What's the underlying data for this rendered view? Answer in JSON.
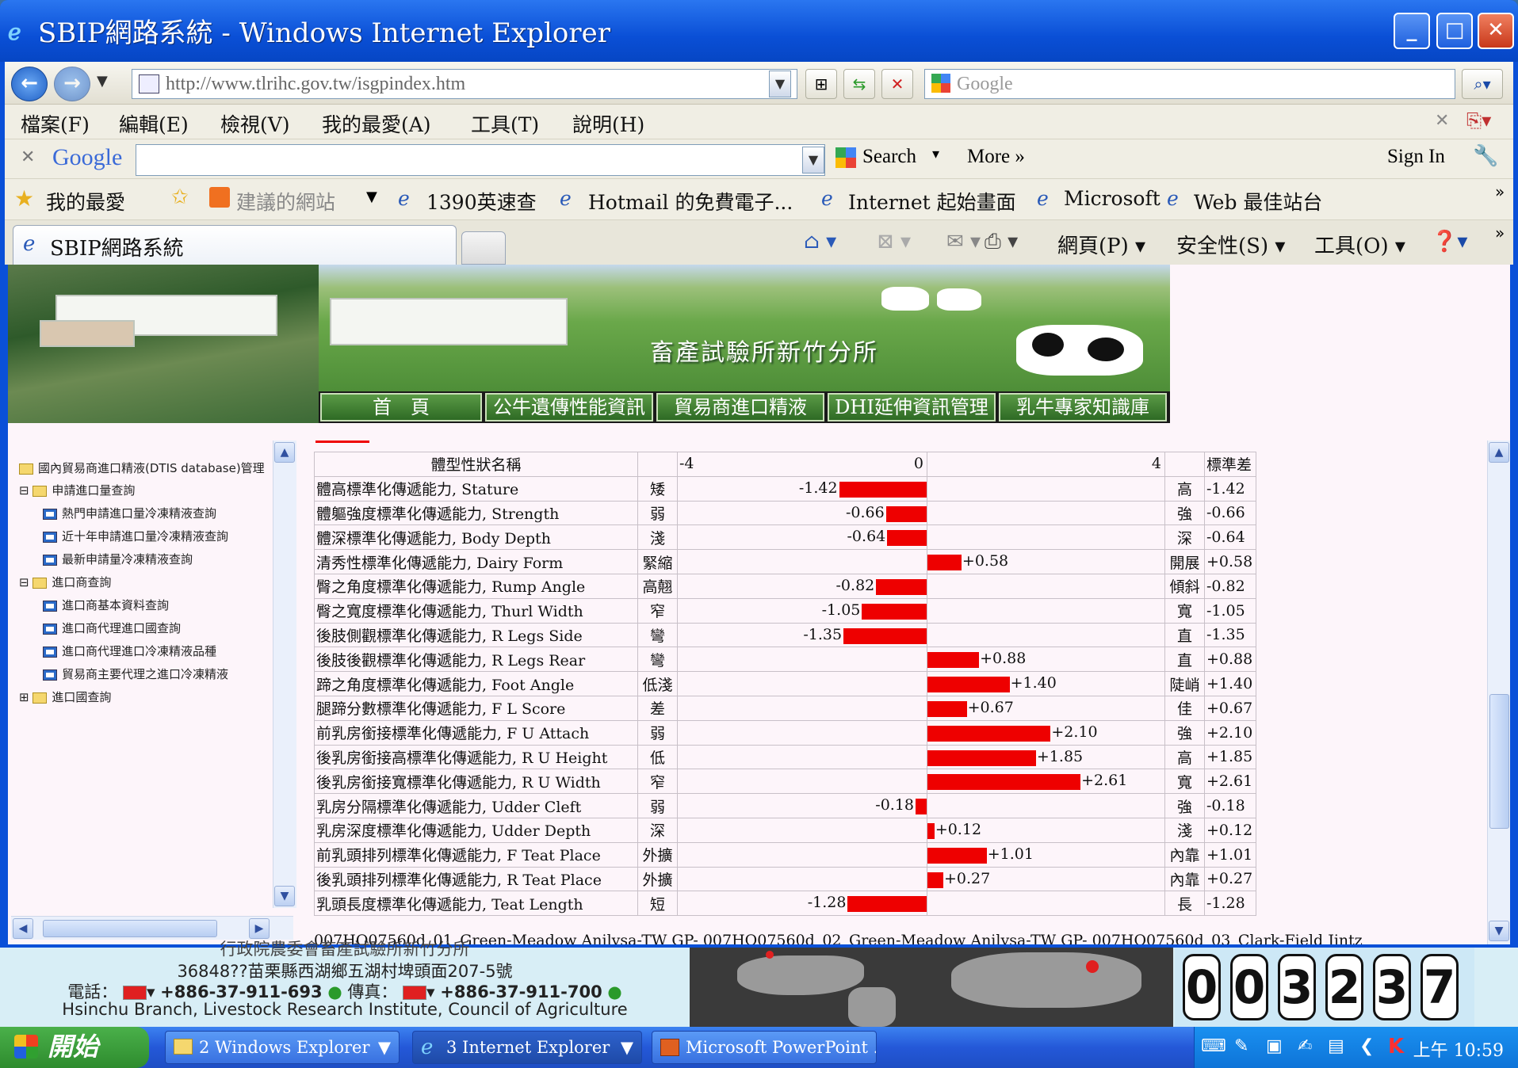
{
  "window": {
    "title": "SBIP網路系統 - Windows Internet Explorer"
  },
  "address": {
    "url": "http://www.tlrihc.gov.tw/isgpindex.htm",
    "search_placeholder": "Google"
  },
  "menu": [
    "檔案(F)",
    "編輯(E)",
    "檢視(V)",
    "我的最愛(A)",
    "工具(T)",
    "說明(H)"
  ],
  "google_bar": {
    "logo": "Google",
    "search": "Search",
    "more": "More »",
    "signin": "Sign In"
  },
  "favorites": {
    "label": "我的最愛",
    "items": [
      "建議的網站",
      "1390英速查",
      "Hotmail 的免費電子...",
      "Internet 起始畫面",
      "Microsoft",
      "Web 最佳站台"
    ]
  },
  "tab": {
    "label": "SBIP網路系統"
  },
  "commands": {
    "page": "網頁(P)",
    "safety": "安全性(S)",
    "tools": "工具(O)"
  },
  "banner": {
    "title": "畜產試驗所新竹分所",
    "nav": [
      "首　頁",
      "公牛遺傳性能資訊",
      "貿易商進口精液",
      "DHI延伸資訊管理",
      "乳牛專家知識庫"
    ]
  },
  "tree": {
    "root": "國內貿易商進口精液(DTIS database)管理",
    "items": [
      {
        "label": "申請進口量查詢",
        "type": "folder",
        "level": 1
      },
      {
        "label": "熱門申請進口量冷凍精液查詢",
        "type": "doc",
        "level": 2
      },
      {
        "label": "近十年申請進口量冷凍精液查詢",
        "type": "doc",
        "level": 2
      },
      {
        "label": "最新申請量冷凍精液查詢",
        "type": "doc",
        "level": 2
      },
      {
        "label": "進口商查詢",
        "type": "folder",
        "level": 1
      },
      {
        "label": "進口商基本資料查詢",
        "type": "doc",
        "level": 2
      },
      {
        "label": "進口商代理進口國查詢",
        "type": "doc",
        "level": 2
      },
      {
        "label": "進口商代理進口冷凍精液品種",
        "type": "doc",
        "level": 2
      },
      {
        "label": "貿易商主要代理之進口冷凍精液",
        "type": "doc",
        "level": 2
      },
      {
        "label": "進口國查詢",
        "type": "folder",
        "level": 1
      }
    ]
  },
  "traits": {
    "header": {
      "name": "體型性狀名稱",
      "min": "-4",
      "zero": "0",
      "max": "4",
      "sd": "標準差"
    },
    "rows": [
      {
        "name": "體高標準化傳遞能力, Stature",
        "lo": "矮",
        "hi": "高",
        "value": -1.42,
        "label": "-1.42"
      },
      {
        "name": "體軀強度標準化傳遞能力, Strength",
        "lo": "弱",
        "hi": "強",
        "value": -0.66,
        "label": "-0.66"
      },
      {
        "name": "體深標準化傳遞能力, Body Depth",
        "lo": "淺",
        "hi": "深",
        "value": -0.64,
        "label": "-0.64"
      },
      {
        "name": "清秀性標準化傳遞能力, Dairy Form",
        "lo": "緊縮",
        "hi": "開展",
        "value": 0.58,
        "label": "+0.58"
      },
      {
        "name": "臀之角度標準化傳遞能力, Rump Angle",
        "lo": "高翹",
        "hi": "傾斜",
        "value": -0.82,
        "label": "-0.82"
      },
      {
        "name": "臀之寬度標準化傳遞能力, Thurl Width",
        "lo": "窄",
        "hi": "寬",
        "value": -1.05,
        "label": "-1.05"
      },
      {
        "name": "後肢側觀標準化傳遞能力, R Legs Side",
        "lo": "彎",
        "hi": "直",
        "value": -1.35,
        "label": "-1.35"
      },
      {
        "name": "後肢後觀標準化傳遞能力, R Legs Rear",
        "lo": "彎",
        "hi": "直",
        "value": 0.88,
        "label": "+0.88"
      },
      {
        "name": "蹄之角度標準化傳遞能力, Foot Angle",
        "lo": "低淺",
        "hi": "陡峭",
        "value": 1.4,
        "label": "+1.40"
      },
      {
        "name": "腿蹄分數標準化傳遞能力, F L Score",
        "lo": "差",
        "hi": "佳",
        "value": 0.67,
        "label": "+0.67"
      },
      {
        "name": "前乳房銜接標準化傳遞能力, F U Attach",
        "lo": "弱",
        "hi": "強",
        "value": 2.1,
        "label": "+2.10"
      },
      {
        "name": "後乳房銜接高標準化傳遞能力, R U Height",
        "lo": "低",
        "hi": "高",
        "value": 1.85,
        "label": "+1.85"
      },
      {
        "name": "後乳房銜接寬標準化傳遞能力, R U Width",
        "lo": "窄",
        "hi": "寬",
        "value": 2.61,
        "label": "+2.61"
      },
      {
        "name": "乳房分隔標準化傳遞能力, Udder Cleft",
        "lo": "弱",
        "hi": "強",
        "value": -0.18,
        "label": "-0.18"
      },
      {
        "name": "乳房深度標準化傳遞能力, Udder Depth",
        "lo": "深",
        "hi": "淺",
        "value": 0.12,
        "label": "+0.12"
      },
      {
        "name": "前乳頭排列標準化傳遞能力, F Teat Place",
        "lo": "外擴",
        "hi": "內靠",
        "value": 1.01,
        "label": "+1.01"
      },
      {
        "name": "後乳頭排列標準化傳遞能力, R Teat Place",
        "lo": "外擴",
        "hi": "內靠",
        "value": 0.27,
        "label": "+0.27"
      },
      {
        "name": "乳頭長度標準化傳遞能力, Teat Length",
        "lo": "短",
        "hi": "長",
        "value": -1.28,
        "label": "-1.28"
      }
    ],
    "bottom_text": "007HO07560d_01_Green-Meadow Anilysa-TW GP-   007HO07560d_02_Green-Meadow Anilysa-TW GP-     007HO07560d_03_Clark-Field Jintz"
  },
  "footer": {
    "line0": "行政院農委會畜產試驗所新竹分所",
    "address": "36848??苗栗縣西湖鄉五湖村埤頭面207-5號",
    "phone_label": "電話：",
    "phone": "+886-37-911-693",
    "fax_label": "傳真：",
    "fax": "+886-37-911-700",
    "english": "Hsinchu Branch, Livestock Research Institute, Council of Agriculture",
    "counter": [
      "0",
      "0",
      "3",
      "2",
      "3",
      "7"
    ]
  },
  "taskbar": {
    "start": "開始",
    "tasks": [
      "2 Windows Explorer",
      "3 Internet Explorer",
      "Microsoft PowerPoint ..."
    ],
    "clock": "上午 10:59"
  },
  "colors": {
    "bar": "#ee0000",
    "title_blue": "#0a4fd6",
    "content_bg": "#fdf5fa"
  }
}
